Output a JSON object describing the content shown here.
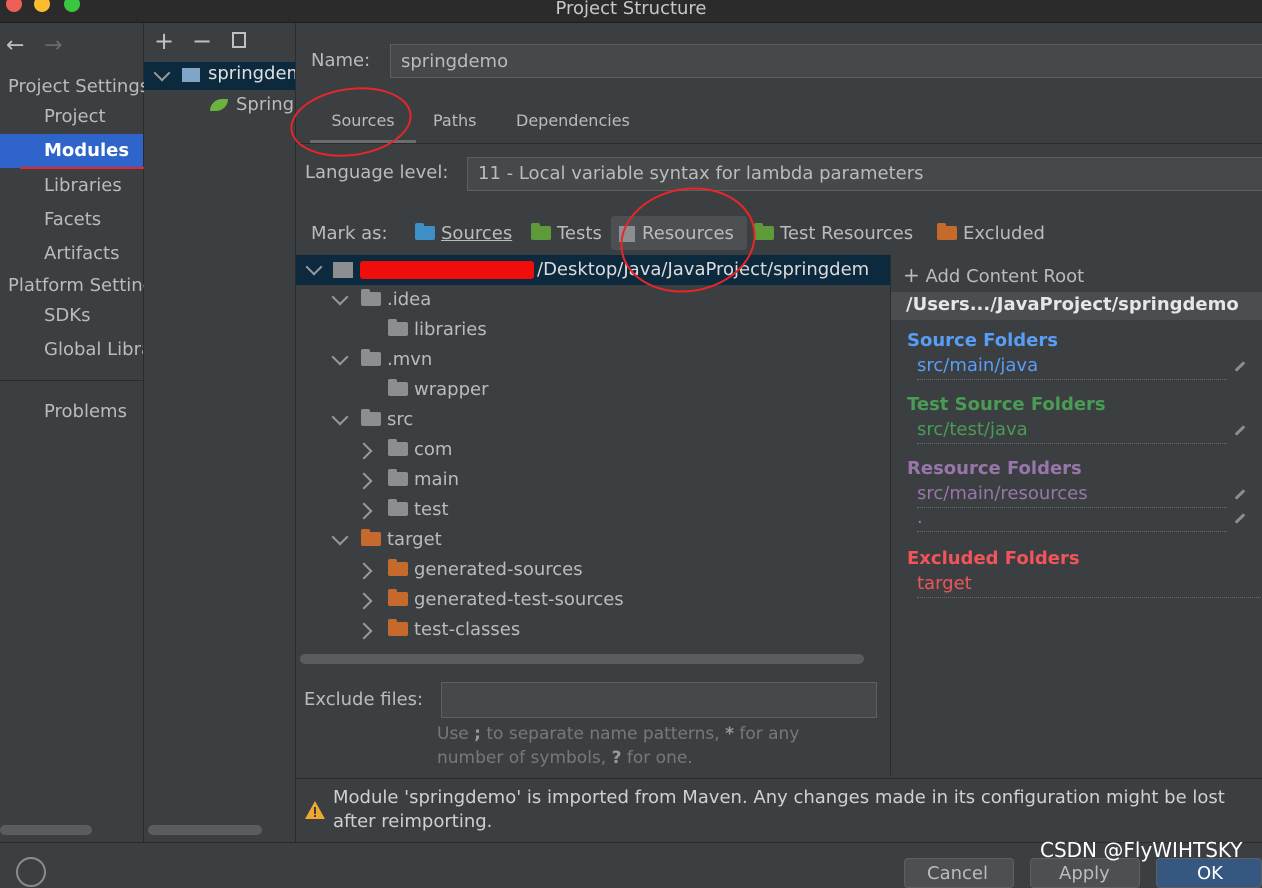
{
  "window": {
    "title": "Project Structure"
  },
  "nav": {
    "project_settings_header": "Project Settings",
    "platform_settings_header": "Platform Settings",
    "items": {
      "project": "Project",
      "modules": "Modules",
      "libraries": "Libraries",
      "facets": "Facets",
      "artifacts": "Artifacts",
      "sdks": "SDKs",
      "global_libraries": "Global Libraries",
      "problems": "Problems"
    }
  },
  "modules": {
    "toolbar": {
      "add": "+",
      "remove": "−"
    },
    "tree": [
      {
        "label": "springdemo"
      },
      {
        "label": "Spring"
      }
    ]
  },
  "main": {
    "name_label": "Name:",
    "name_value": "springdemo",
    "tabs": {
      "sources": "Sources",
      "paths": "Paths",
      "dependencies": "Dependencies"
    },
    "language_level_label": "Language level:",
    "language_level_value": "11 - Local variable syntax for lambda parameters",
    "mark_as_label": "Mark as:",
    "mark_as": {
      "sources": "Sources",
      "tests": "Tests",
      "resources": "Resources",
      "test_resources": "Test Resources",
      "excluded": "Excluded"
    },
    "tree": {
      "root": "/Users/xxxxxxxxxx/Desktop/Java/JavaProject/springdemo",
      "root_visible": "/Desktop/Java/JavaProject/springdem",
      "idea": ".idea",
      "libraries": "libraries",
      "mvn": ".mvn",
      "wrapper": "wrapper",
      "src": "src",
      "com": "com",
      "main": "main",
      "test": "test",
      "target": "target",
      "generated_sources": "generated-sources",
      "generated_test_sources": "generated-test-sources",
      "test_classes": "test-classes"
    },
    "exclude_label": "Exclude files:",
    "exclude_value": "",
    "hint_line1_a": "Use ",
    "hint_line1_b": ";",
    "hint_line1_c": " to separate name patterns, ",
    "hint_line1_d": "*",
    "hint_line1_e": " for any",
    "hint_line2_a": "number of symbols, ",
    "hint_line2_b": "?",
    "hint_line2_c": " for one.",
    "warning_line1": "Module 'springdemo' is imported from Maven. Any changes made in its configuration might be lost",
    "warning_line2": "after reimporting."
  },
  "content_root": {
    "add_label": "Add Content Root",
    "path": "/Users.../JavaProject/springdemo",
    "source_header": "Source Folders",
    "source_path": "src/main/java",
    "test_header": "Test Source Folders",
    "test_path": "src/test/java",
    "resource_header": "Resource Folders",
    "resource_path": "src/main/resources",
    "resource_path2": ".",
    "excluded_header": "Excluded Folders",
    "excluded_path": "target"
  },
  "footer": {
    "cancel": "Cancel",
    "apply": "Apply",
    "ok": "OK"
  },
  "watermark": "CSDN @FlyWIHTSKY",
  "colors": {
    "accent": "#2f65ca",
    "source": "#589df6",
    "test": "#499c54",
    "resource": "#9876aa",
    "excluded": "#f2545b",
    "annotation_red": "#e8262a"
  }
}
